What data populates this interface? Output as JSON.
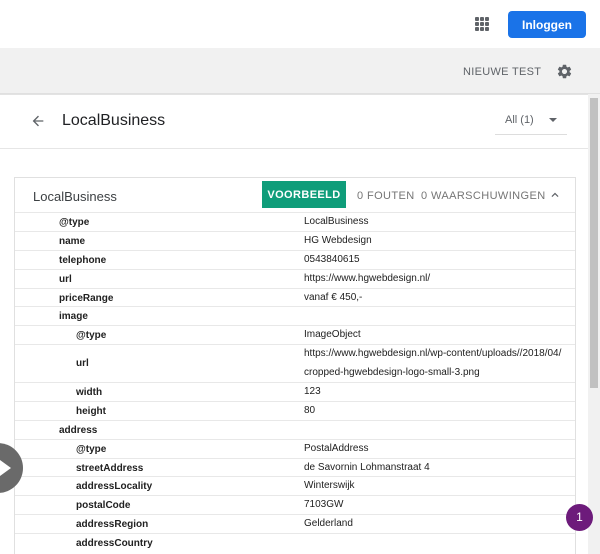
{
  "header": {
    "apps_icon": "apps-grid-icon",
    "login_label": "Inloggen"
  },
  "toolbar": {
    "new_test_label": "NIEUWE TEST",
    "settings_icon": "gear-icon"
  },
  "panel": {
    "title": "LocalBusiness",
    "filter_label": "All (1)"
  },
  "card": {
    "title": "LocalBusiness",
    "preview_label": "VOORBEELD",
    "errors_label": "0 FOUTEN",
    "warnings_label": "0 WAARSCHUWINGEN",
    "accent": "#0f9d7a"
  },
  "properties": [
    {
      "key": "@type",
      "value": "LocalBusiness"
    },
    {
      "key": "name",
      "value": "HG Webdesign"
    },
    {
      "key": "telephone",
      "value": "0543840615"
    },
    {
      "key": "url",
      "value": "https://www.hgwebdesign.nl/"
    },
    {
      "key": "priceRange",
      "value": "vanaf € 450,-"
    },
    {
      "key": "image",
      "value": ""
    },
    {
      "key": "@type",
      "value": "ImageObject"
    },
    {
      "key": "url",
      "value": "https://www.hgwebdesign.nl/wp-content/uploads//2018/04/cropped-hgwebdesign-logo-small-3.png"
    },
    {
      "key": "width",
      "value": "123"
    },
    {
      "key": "height",
      "value": "80"
    },
    {
      "key": "address",
      "value": ""
    },
    {
      "key": "@type",
      "value": "PostalAddress"
    },
    {
      "key": "streetAddress",
      "value": "de Savornin Lohmanstraat 4"
    },
    {
      "key": "addressLocality",
      "value": "Winterswijk"
    },
    {
      "key": "postalCode",
      "value": "7103GW"
    },
    {
      "key": "addressRegion",
      "value": "Gelderland"
    },
    {
      "key": "addressCountry",
      "value": ""
    }
  ],
  "notification_count": "1",
  "colors": {
    "primary": "#1a73e8",
    "badge": "#6d1b7b"
  }
}
